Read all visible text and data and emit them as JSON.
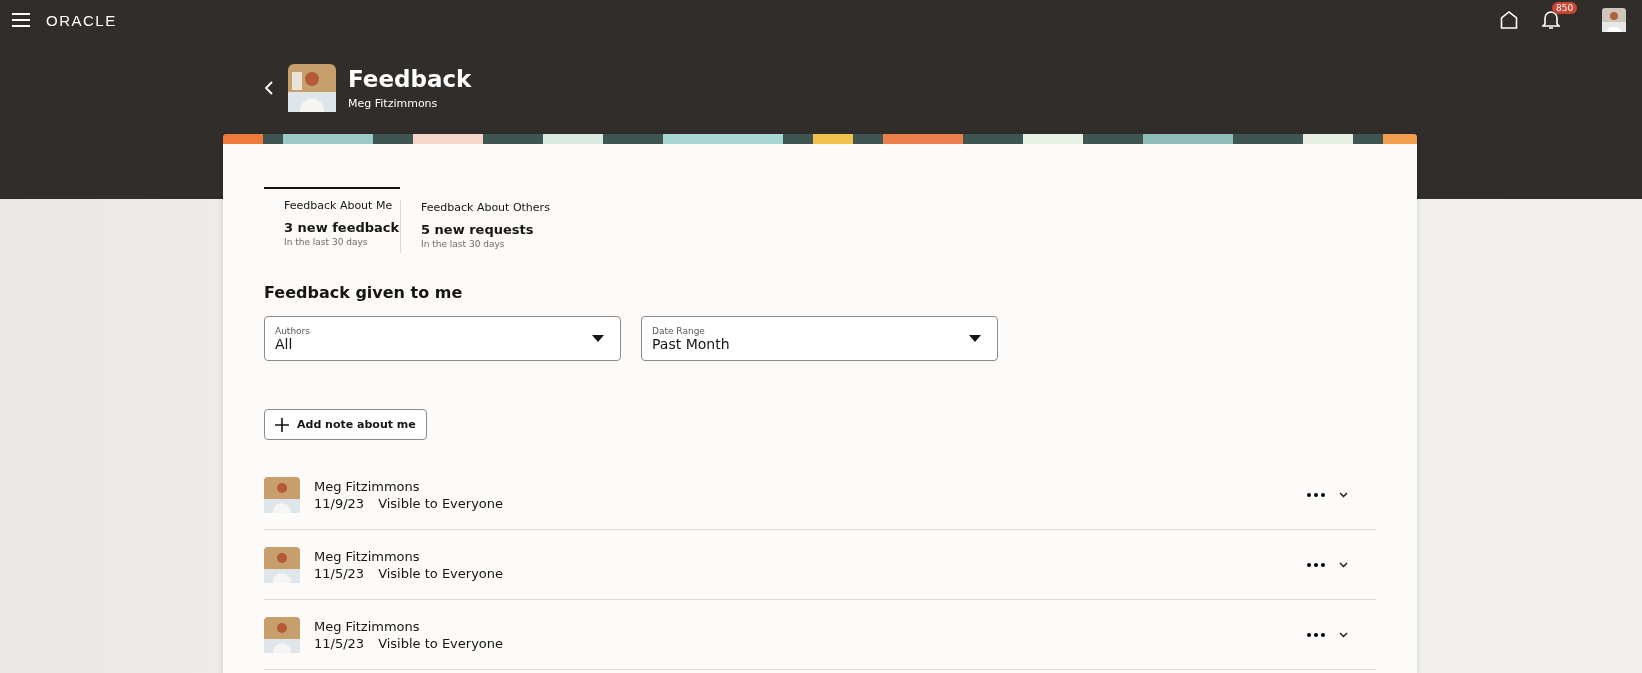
{
  "top_bar": {
    "logo": "ORACLE",
    "notification_count": "850"
  },
  "header": {
    "title": "Feedback",
    "subtitle": "Meg Fitzimmons"
  },
  "tabs": [
    {
      "label": "Feedback About Me",
      "count": "3 new feedback",
      "period": "In the last 30 days",
      "selected": true
    },
    {
      "label": "Feedback About Others",
      "count": "5 new requests",
      "period": "In the last 30 days",
      "selected": false
    }
  ],
  "section_title": "Feedback given to me",
  "filters": [
    {
      "label": "Authors",
      "value": "All"
    },
    {
      "label": "Date Range",
      "value": "Past Month"
    }
  ],
  "add_button": "Add note about me",
  "feedback": [
    {
      "author": "Meg Fitzimmons",
      "date": "11/9/23",
      "visibility": "Visible to Everyone"
    },
    {
      "author": "Meg Fitzimmons",
      "date": "11/5/23",
      "visibility": "Visible to Everyone"
    },
    {
      "author": "Meg Fitzimmons",
      "date": "11/5/23",
      "visibility": "Visible to Everyone"
    }
  ]
}
